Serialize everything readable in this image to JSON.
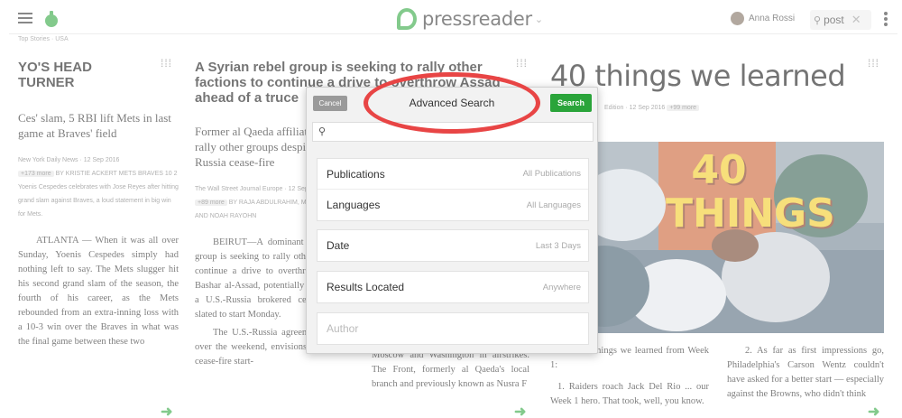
{
  "topbar": {
    "logo_text": "pressreader",
    "user_name": "Anna Rossi",
    "search_value": "post"
  },
  "breadcrumb": "Top Stories · USA",
  "articles": [
    {
      "title": "YO'S HEAD TURNER",
      "subtitle": "Ces' slam, 5 RBI lift Mets in last game at Braves' field",
      "meta": "New York Daily News · 12 Sep 2016",
      "tag": "+173 more",
      "byline": "BY KRISTIE ACKERT METS BRAVES 10 2 Yoenis Cespedes celebrates with Jose Reyes after hitting grand slam against Braves, a loud statement in big win for Mets.",
      "body": "ATLANTA — When it was all over Sunday, Yoenis Cespedes simply had nothing left to say. The Mets slugger hit his second grand slam of the season, the fourth of his career, as the Mets rebounded from an extra-inning loss with a 10-3 win over the Braves in what was the final game between these two"
    },
    {
      "title": "A Syrian rebel group is seeking to rally other factions to continue a drive to overthrow Assad ahead of a truce",
      "subtitle": "Former al Qaeda affiliate seeks to rally other groups despite U.S.-Russia cease-fire",
      "meta": "The Wall Street Journal Europe · 12 Sep 2016",
      "tag": "+89 more",
      "byline": "BY RAJA ABDULRAHIM, MARIA ABI-HABIB AND NOAH RAYOHN",
      "body": "BEIRUT—A dominant Syrian rebel group is seeking to rally other factions to continue a drive to overthrow President Bashar al-Assad, potentially complicating a U.S.-Russia brokered cease-fire deal slated to start Monday.",
      "body2": "The U.S.-Russia agreement, reached over the weekend, envisions a seven-day cease-fire start-",
      "body3": "Moscow and Washington in airstrikes. The Front, formerly al Qaeda's local branch and previously known as Nusra F"
    },
    {
      "title": "40 things we learned",
      "meta": "Edition · 12 Sep 2016",
      "tag": "+99 more",
      "photo_text": "40 THINGS",
      "body_left": "40 things we learned from Week 1:",
      "body_left2": "1. Raiders roach Jack Del Rio ... our Week 1 hero. That took, well, you know.",
      "body_right": "2. As far as first impressions go, Philadelphia's Carson Wentz couldn't have asked for a better start — especially against the Browns, who didn't think"
    }
  ],
  "modal": {
    "title": "Advanced Search",
    "cancel_label": "Cancel",
    "search_label": "Search",
    "search_placeholder": "",
    "rows": [
      {
        "label": "Publications",
        "value": "All Publications"
      },
      {
        "label": "Languages",
        "value": "All Languages"
      },
      {
        "label": "Date",
        "value": "Last 3 Days"
      },
      {
        "label": "Results Located",
        "value": "Anywhere"
      }
    ],
    "author_placeholder": "Author"
  },
  "colors": {
    "brand_green": "#2aa43a",
    "annotation_red": "#e84545"
  }
}
